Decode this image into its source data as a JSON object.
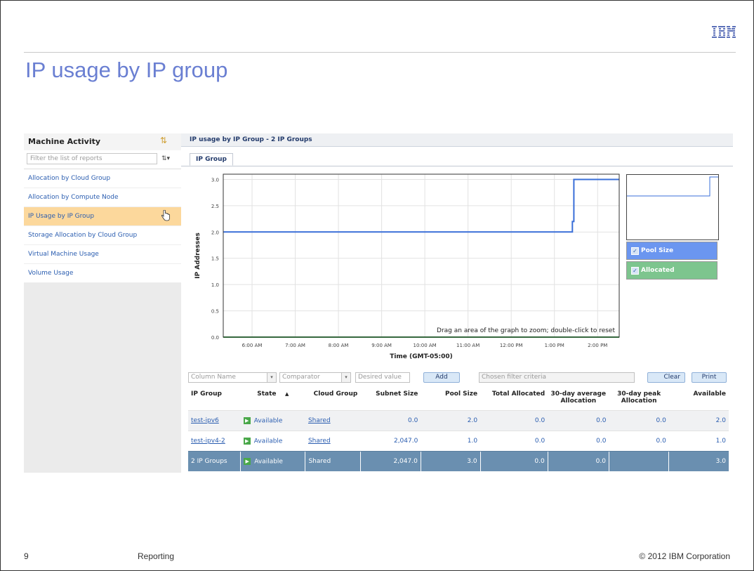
{
  "slide": {
    "title": "IP usage by IP group",
    "logo": "IBM",
    "page_number": "9",
    "section": "Reporting",
    "copyright": "© 2012 IBM Corporation"
  },
  "sidebar": {
    "title": "Machine Activity",
    "filter_placeholder": "Filter the list of reports",
    "sort_label": "⇅▾",
    "items": [
      {
        "label": "Allocation by Cloud Group"
      },
      {
        "label": "Allocation by Compute Node"
      },
      {
        "label": "IP Usage by IP Group",
        "selected": true
      },
      {
        "label": "Storage Allocation by Cloud Group"
      },
      {
        "label": "Virtual Machine Usage"
      },
      {
        "label": "Volume Usage"
      }
    ]
  },
  "report": {
    "header": "IP usage by IP Group - 2 IP Groups",
    "tab": "IP Group",
    "zoom_hint": "Drag an area of the graph to zoom; double-click to reset",
    "legend": [
      {
        "label": "Pool Size",
        "color": "#6b96f0"
      },
      {
        "label": "Allocated",
        "color": "#7dc58e"
      }
    ]
  },
  "chart_data": {
    "type": "line",
    "ylabel": "IP Addresses",
    "xlabel": "Time (GMT-05:00)",
    "ylim": [
      0,
      3.1
    ],
    "yticks": [
      "0.0",
      "0.5",
      "1.0",
      "1.5",
      "2.0",
      "2.5",
      "3.0"
    ],
    "xticks": [
      "6:00 AM",
      "7:00 AM",
      "8:00 AM",
      "9:00 AM",
      "10:00 AM",
      "11:00 AM",
      "12:00 PM",
      "1:00 PM",
      "2:00 PM"
    ],
    "xlim": [
      "5:20 AM",
      "2:30 PM"
    ],
    "grid": true,
    "series": [
      {
        "name": "Pool Size",
        "color": "#3a6fd8",
        "points": [
          [
            "5:20 AM",
            2.0
          ],
          [
            "1:25 PM",
            2.0
          ],
          [
            "1:25 PM",
            2.2
          ],
          [
            "1:27 PM",
            2.2
          ],
          [
            "1:27 PM",
            3.0
          ],
          [
            "2:30 PM",
            3.0
          ]
        ]
      },
      {
        "name": "Allocated",
        "color": "#3a9e4a",
        "points": [
          [
            "5:20 AM",
            0.0
          ],
          [
            "2:30 PM",
            0.0
          ]
        ]
      }
    ]
  },
  "filters": {
    "column_placeholder": "Column Name",
    "comparator_placeholder": "Comparator",
    "value_placeholder": "Desired value",
    "add_label": "Add",
    "criteria_placeholder": "Chosen filter criteria",
    "clear_label": "Clear",
    "print_label": "Print"
  },
  "table": {
    "columns": [
      "IP Group",
      "State",
      "Cloud Group",
      "Subnet Size",
      "Pool Size",
      "Total Allocated",
      "30-day average Allocation",
      "30-day peak Allocation",
      "Available"
    ],
    "sort_indicator": "▲",
    "rows": [
      {
        "ip_group": "test-ipv6",
        "state": "Available",
        "cloud_group": "Shared",
        "subnet_size": "0.0",
        "pool_size": "2.0",
        "total_allocated": "0.0",
        "avg_alloc": "0.0",
        "peak_alloc": "0.0",
        "available": "2.0"
      },
      {
        "ip_group": "test-ipv4-2",
        "state": "Available",
        "cloud_group": "Shared",
        "subnet_size": "2,047.0",
        "pool_size": "1.0",
        "total_allocated": "0.0",
        "avg_alloc": "0.0",
        "peak_alloc": "0.0",
        "available": "1.0"
      }
    ],
    "total": {
      "ip_group": "2 IP Groups",
      "state": "Available",
      "cloud_group": "Shared",
      "subnet_size": "2,047.0",
      "pool_size": "3.0",
      "total_allocated": "0.0",
      "avg_alloc": "0.0",
      "peak_alloc": "",
      "available": "3.0"
    }
  }
}
